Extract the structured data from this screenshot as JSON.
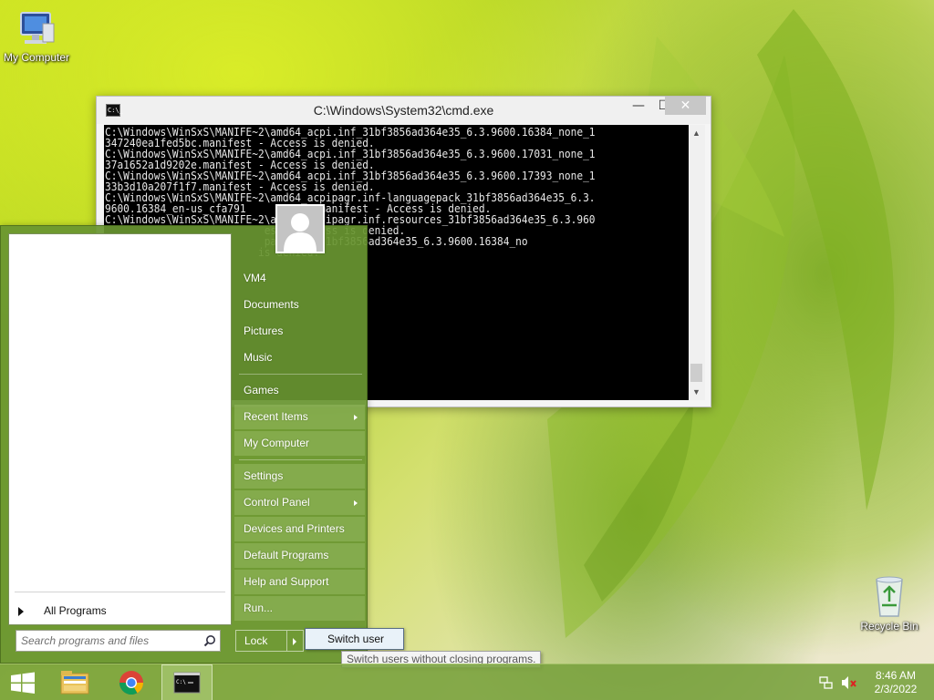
{
  "desktop": {
    "icons": {
      "my_computer": "My Computer",
      "recycle_bin": "Recycle Bin"
    }
  },
  "cmd_window": {
    "title": "C:\\Windows\\System32\\cmd.exe",
    "icon_text": "C:\\_",
    "buttons": {
      "minimize": "—",
      "maximize": "☐",
      "close": "✕"
    },
    "lines": [
      "C:\\Windows\\WinSxS\\MANIFE~2\\amd64_acpi.inf_31bf3856ad364e35_6.3.9600.16384_none_1",
      "347240ea1fed5bc.manifest - Access is denied.",
      "C:\\Windows\\WinSxS\\MANIFE~2\\amd64_acpi.inf_31bf3856ad364e35_6.3.9600.17031_none_1",
      "37a1652a1d9202e.manifest - Access is denied.",
      "C:\\Windows\\WinSxS\\MANIFE~2\\amd64_acpi.inf_31bf3856ad364e35_6.3.9600.17393_none_1",
      "33b3d10a207f1f7.manifest - Access is denied.",
      "C:\\Windows\\WinSxS\\MANIFE~2\\amd64_acpipagr.inf-languagepack_31bf3856ad364e35_6.3.",
      "9600.16384_en-us_cfa791        817.manifest - Access is denied.",
      "C:\\Windows\\WinSxS\\MANIFE~2\\amd64_acpipagr.inf.resources_31bf3856ad364e35_6.3.960",
      "                          est - Access is denied.",
      "                          pagr.inf_31bf3856ad364e35_6.3.9600.16384_no",
      "                         is denied."
    ]
  },
  "start_menu": {
    "all_programs": "All Programs",
    "search_placeholder": "Search programs and files",
    "items": [
      {
        "label": "VM4",
        "submenu": false
      },
      {
        "label": "Documents",
        "submenu": false
      },
      {
        "label": "Pictures",
        "submenu": false
      },
      {
        "label": "Music",
        "submenu": false
      },
      {
        "label": "Games",
        "submenu": false
      },
      {
        "label": "Recent Items",
        "submenu": true
      },
      {
        "label": "My Computer",
        "submenu": false
      },
      {
        "label": "Settings",
        "submenu": false
      },
      {
        "label": "Control Panel",
        "submenu": true
      },
      {
        "label": "Devices and Printers",
        "submenu": false
      },
      {
        "label": "Default Programs",
        "submenu": false
      },
      {
        "label": "Help and Support",
        "submenu": false
      },
      {
        "label": "Run...",
        "submenu": false
      }
    ],
    "lock_label": "Lock",
    "switch_user_label": "Switch user",
    "switch_user_tooltip": "Switch users without closing programs."
  },
  "taskbar": {
    "time": "8:46 AM",
    "date": "2/3/2022",
    "accent": "#7aa03c"
  }
}
